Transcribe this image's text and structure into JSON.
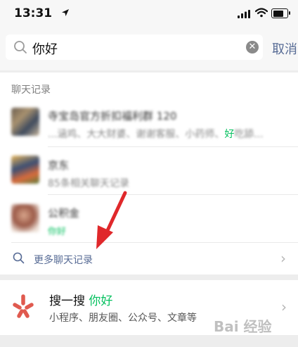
{
  "status_bar": {
    "time": "13:31"
  },
  "search": {
    "query": "你好",
    "cancel_label": "取消"
  },
  "chat_history": {
    "section_title": "聊天记录",
    "results": [
      {
        "name": "寺宝岛官方折扣福利群 120",
        "snippet_prefix": "...涵鸡、大大财婆、谢谢客服、小药师、",
        "snippet_highlight": "好",
        "snippet_suffix": "吃舔..."
      },
      {
        "name": "京东",
        "snippet": "85条相关聊天记录"
      },
      {
        "name": "公积金",
        "snippet": "你好"
      }
    ],
    "more_label": "更多聊天记录"
  },
  "souyisou": {
    "title_prefix": "搜一搜",
    "title_highlight": "你好",
    "subtitle": "小程序、朋友圈、公众号、文章等"
  },
  "watermark": "Bai 经验",
  "colors": {
    "accent_green": "#07c160",
    "link_blue": "#576b95",
    "annotation_red": "#e0282b"
  }
}
